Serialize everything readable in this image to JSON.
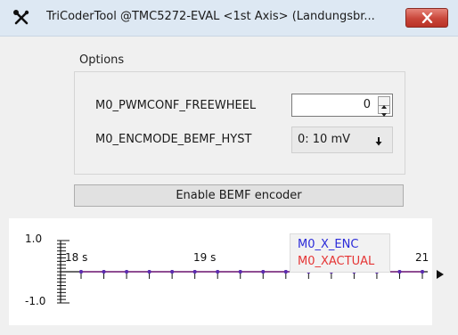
{
  "window": {
    "title": "TriCoderTool @TMC5272-EVAL <1st Axis> (Landungsbr...",
    "app_icon": "tools-icon",
    "close_icon": "close-icon",
    "close_color": "#c9463a"
  },
  "options": {
    "group_label": "Options",
    "freewheel_label": "M0_PWMCONF_FREEWHEEL",
    "freewheel_value": "0",
    "bemf_hyst_label": "M0_ENCMODE_BEMF_HYST",
    "bemf_hyst_value": "0: 10 mV"
  },
  "enable_button_label": "Enable BEMF encoder",
  "chart_data": {
    "type": "line",
    "y_ticks": [
      "1.0",
      "-1.0"
    ],
    "x_ticks": [
      "18 s",
      "19 s",
      "21"
    ],
    "ylim": [
      -1.0,
      1.0
    ],
    "series": [
      {
        "name": "M0_X_ENC",
        "color": "#2b2bd9",
        "x": [
          18.0,
          18.2,
          18.4,
          18.6,
          18.8,
          19.0,
          19.2,
          19.4,
          19.6,
          19.8,
          20.0,
          20.2,
          20.4,
          20.6,
          20.8,
          21.0
        ],
        "y": [
          0,
          0,
          0,
          0,
          0,
          0,
          0,
          0,
          0,
          0,
          0,
          0,
          0,
          0,
          0,
          0
        ]
      },
      {
        "name": "M0_XACTUAL",
        "color": "#e53535",
        "x": [
          18.0,
          18.2,
          18.4,
          18.6,
          18.8,
          19.0,
          19.2,
          19.4,
          19.6,
          19.8,
          20.0,
          20.2,
          20.4,
          20.6,
          20.8,
          21.0
        ],
        "y": [
          0,
          0,
          0,
          0,
          0,
          0,
          0,
          0,
          0,
          0,
          0,
          0,
          0,
          0,
          0,
          0
        ]
      }
    ],
    "legend_position": "top-right"
  }
}
